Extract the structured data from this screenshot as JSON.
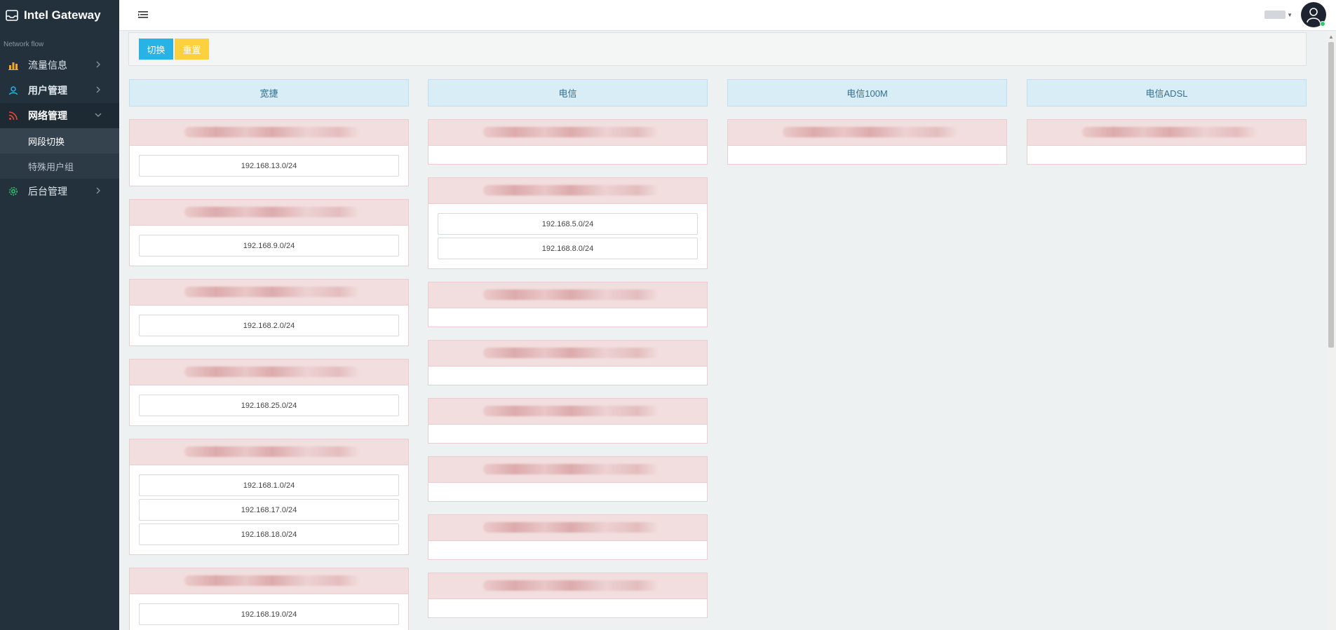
{
  "app": {
    "title": "Intel Gateway",
    "section_label": "Network flow"
  },
  "sidebar": {
    "items": [
      {
        "label": "流量信息",
        "icon": "bar-chart-icon",
        "color": "#f5a623"
      },
      {
        "label": "用户管理",
        "icon": "users-icon",
        "color": "#27b3e6"
      },
      {
        "label": "网络管理",
        "icon": "wifi-icon",
        "color": "#e74c3c",
        "sub": [
          "网段切换",
          "特殊用户组"
        ]
      },
      {
        "label": "后台管理",
        "icon": "gear-icon",
        "color": "#2ecc71"
      }
    ]
  },
  "toolbar": {
    "switch_label": "切换",
    "reset_label": "重置"
  },
  "columns": [
    {
      "header": "宽捷",
      "cards": [
        {
          "subnets": [
            "192.168.13.0/24"
          ]
        },
        {
          "subnets": [
            "192.168.9.0/24"
          ]
        },
        {
          "subnets": [
            "192.168.2.0/24"
          ]
        },
        {
          "subnets": [
            "192.168.25.0/24"
          ]
        },
        {
          "subnets": [
            "192.168.1.0/24",
            "192.168.17.0/24",
            "192.168.18.0/24"
          ]
        },
        {
          "subnets": [
            "192.168.19.0/24"
          ]
        }
      ]
    },
    {
      "header": "电信",
      "cards": [
        {
          "subnets": []
        },
        {
          "subnets": [
            "192.168.5.0/24",
            "192.168.8.0/24"
          ]
        },
        {
          "subnets": []
        },
        {
          "subnets": []
        },
        {
          "subnets": []
        },
        {
          "subnets": []
        },
        {
          "subnets": []
        },
        {
          "subnets": []
        }
      ]
    },
    {
      "header": "电信100M",
      "cards": [
        {
          "subnets": []
        }
      ]
    },
    {
      "header": "电信ADSL",
      "cards": [
        {
          "subnets": []
        }
      ]
    }
  ]
}
